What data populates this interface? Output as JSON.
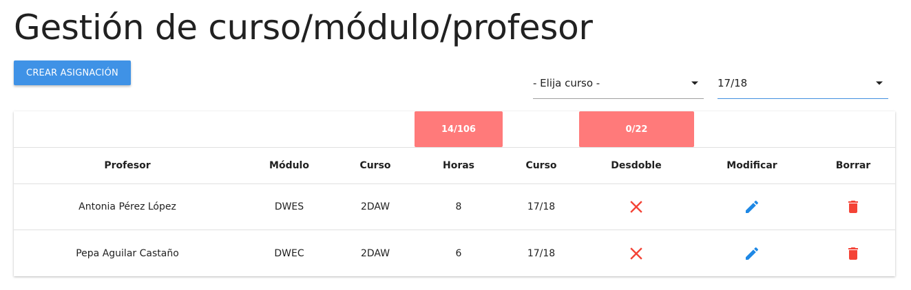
{
  "page": {
    "title": "Gestión de curso/módulo/profesor"
  },
  "toolbar": {
    "create_label": "CREAR ASIGNACIÓN"
  },
  "filters": {
    "curso": {
      "value": "- Elija curso -"
    },
    "year": {
      "value": "17/18"
    }
  },
  "summary": {
    "horas": "14/106",
    "desdoble": "0/22"
  },
  "table": {
    "headers": [
      "Profesor",
      "Módulo",
      "Curso",
      "Horas",
      "Curso",
      "Desdoble",
      "Modificar",
      "Borrar"
    ],
    "rows": [
      {
        "profesor": "Antonia Pérez López",
        "modulo": "DWES",
        "curso": "2DAW",
        "horas": "8",
        "anio": "17/18",
        "desdoble": "close-icon",
        "modificar": "pencil-icon",
        "borrar": "trash-icon"
      },
      {
        "profesor": "Pepa Aguilar Castaño",
        "modulo": "DWEC",
        "curso": "2DAW",
        "horas": "6",
        "anio": "17/18",
        "desdoble": "close-icon",
        "modificar": "pencil-icon",
        "borrar": "trash-icon"
      }
    ]
  },
  "colors": {
    "primary": "#3f92e6",
    "badge": "#ff7a7a",
    "danger": "#f44336",
    "edit": "#1e88e5"
  }
}
